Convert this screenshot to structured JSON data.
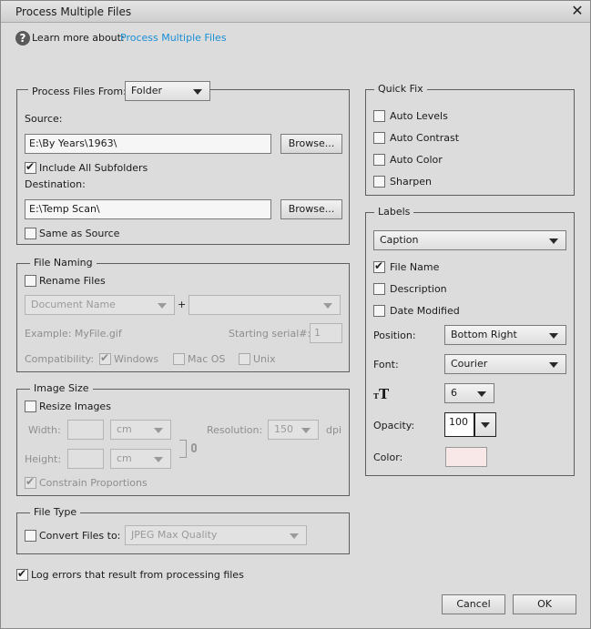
{
  "window": {
    "title": "Process Multiple Files"
  },
  "help": {
    "prefix": "Learn more about:",
    "link": "Process Multiple Files"
  },
  "process_from": {
    "label": "Process Files From:",
    "value": "Folder"
  },
  "source": {
    "label": "Source:",
    "path": "E:\\By Years\\1963\\",
    "browse": "Browse...",
    "include_subfolders": "Include All Subfolders"
  },
  "destination": {
    "label": "Destination:",
    "path": "E:\\Temp Scan\\",
    "browse": "Browse...",
    "same_as_source": "Same as Source"
  },
  "file_naming": {
    "title": "File Naming",
    "rename": "Rename Files",
    "name_select": "Document Name",
    "plus": "+",
    "second_select": "",
    "example": "Example: MyFile.gif",
    "serial_label": "Starting serial#:",
    "serial_value": "1",
    "compat_label": "Compatibility:",
    "windows": "Windows",
    "macos": "Mac OS",
    "unix": "Unix"
  },
  "image_size": {
    "title": "Image Size",
    "resize": "Resize Images",
    "width_label": "Width:",
    "width_unit": "cm",
    "height_label": "Height:",
    "height_unit": "cm",
    "resolution_label": "Resolution:",
    "resolution_value": "150",
    "dpi": "dpi",
    "constrain": "Constrain Proportions"
  },
  "file_type": {
    "title": "File Type",
    "convert": "Convert Files to:",
    "format": "JPEG Max Quality"
  },
  "log_errors": "Log errors that result from processing files",
  "quick_fix": {
    "title": "Quick Fix",
    "items": [
      "Auto Levels",
      "Auto Contrast",
      "Auto Color",
      "Sharpen"
    ]
  },
  "labels": {
    "title": "Labels",
    "type": "Caption",
    "file_name": "File Name",
    "description": "Description",
    "date_modified": "Date Modified",
    "position_label": "Position:",
    "position_value": "Bottom Right",
    "font_label": "Font:",
    "font_value": "Courier",
    "font_size": "6",
    "opacity_label": "Opacity:",
    "opacity_value": "100",
    "color_label": "Color:",
    "color_value": "#f8e8e8"
  },
  "buttons": {
    "cancel": "Cancel",
    "ok": "OK"
  }
}
